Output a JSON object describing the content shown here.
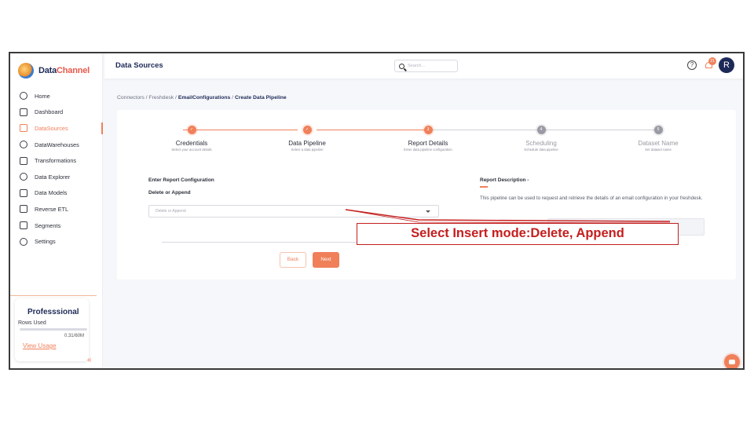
{
  "brand": {
    "name_part1": "Data",
    "name_part2": "Channel",
    "accent": "#f0805a",
    "navy": "#1d2a57"
  },
  "sidebar": {
    "items": [
      {
        "label": "Home",
        "icon": "home-icon"
      },
      {
        "label": "Dashboard",
        "icon": "dashboard-icon"
      },
      {
        "label": "DataSources",
        "icon": "datasources-icon",
        "active": true
      },
      {
        "label": "DataWarehouses",
        "icon": "database-icon"
      },
      {
        "label": "Transformations",
        "icon": "transform-icon"
      },
      {
        "label": "Data Explorer",
        "icon": "explorer-icon"
      },
      {
        "label": "Data Models",
        "icon": "models-icon"
      },
      {
        "label": "Reverse ETL",
        "icon": "reverse-etl-icon"
      },
      {
        "label": "Segments",
        "icon": "segments-icon"
      },
      {
        "label": "Settings",
        "icon": "gear-icon"
      }
    ],
    "plan": {
      "title": "Professsional",
      "rows_label": "Rows Used",
      "rows_count": "0.31/60M",
      "rows_fraction": 0.005,
      "link": "View Usage"
    },
    "collapse_glyph": "«"
  },
  "header": {
    "title": "Data Sources",
    "search_placeholder": "Search...",
    "help_glyph": "?",
    "notification_count": "21",
    "avatar_initial": "R"
  },
  "breadcrumb": {
    "path": "Connectors / Freshdesk / ",
    "current_1": "EmailConfigurations",
    "sep": " / ",
    "current_2": "Create Data Pipeline"
  },
  "steps": [
    {
      "index": "",
      "title": "Credentials",
      "subtitle": "Select your account details",
      "state": "done"
    },
    {
      "index": "",
      "title": "Data Pipeline",
      "subtitle": "Select a data pipeline",
      "state": "done"
    },
    {
      "index": "3",
      "title": "Report Details",
      "subtitle": "Enter data pipeline configuration",
      "state": "current"
    },
    {
      "index": "4",
      "title": "Scheduling",
      "subtitle": "Schedule data pipeline",
      "state": "todo"
    },
    {
      "index": "5",
      "title": "Dataset Name",
      "subtitle": "Set dataset name",
      "state": "todo"
    }
  ],
  "form": {
    "section_title": "Enter Report Configuration",
    "field_label": "Delete or Append",
    "field_placeholder": "Delete or Append"
  },
  "buttons": {
    "back": "Back",
    "next": "Next"
  },
  "description": {
    "title": "Report Description -",
    "text": "This pipeline can be used to request and retrieve the details of an email configuration in your freshdesk."
  },
  "annotation": {
    "text": "Select Insert mode:Delete, Append",
    "color": "#c41e1e"
  }
}
